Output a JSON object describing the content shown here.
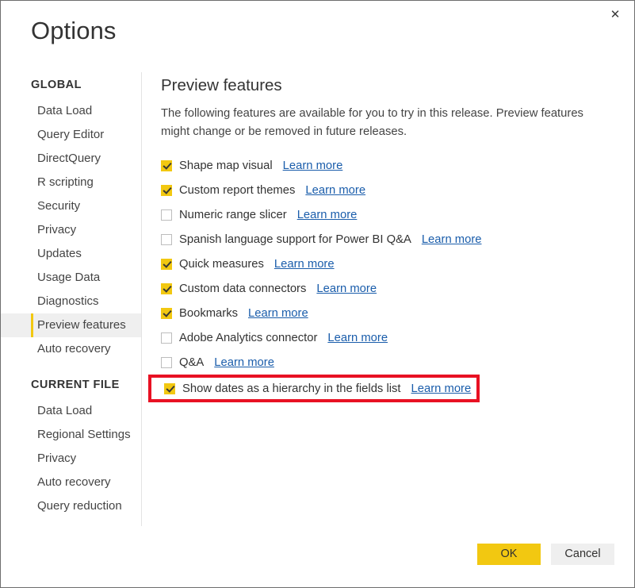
{
  "window": {
    "title": "Options",
    "close_icon": "close-icon",
    "close_glyph": "✕"
  },
  "sidebar": {
    "groups": [
      {
        "title": "GLOBAL",
        "items": [
          {
            "label": "Data Load",
            "selected": false
          },
          {
            "label": "Query Editor",
            "selected": false
          },
          {
            "label": "DirectQuery",
            "selected": false
          },
          {
            "label": "R scripting",
            "selected": false
          },
          {
            "label": "Security",
            "selected": false
          },
          {
            "label": "Privacy",
            "selected": false
          },
          {
            "label": "Updates",
            "selected": false
          },
          {
            "label": "Usage Data",
            "selected": false
          },
          {
            "label": "Diagnostics",
            "selected": false
          },
          {
            "label": "Preview features",
            "selected": true
          },
          {
            "label": "Auto recovery",
            "selected": false
          }
        ]
      },
      {
        "title": "CURRENT FILE",
        "items": [
          {
            "label": "Data Load",
            "selected": false
          },
          {
            "label": "Regional Settings",
            "selected": false
          },
          {
            "label": "Privacy",
            "selected": false
          },
          {
            "label": "Auto recovery",
            "selected": false
          },
          {
            "label": "Query reduction",
            "selected": false
          }
        ]
      }
    ]
  },
  "main": {
    "heading": "Preview features",
    "description": "The following features are available for you to try in this release. Preview features might change or be removed in future releases.",
    "learn_more_label": "Learn more",
    "features": [
      {
        "label": "Shape map visual",
        "checked": true,
        "highlighted": false
      },
      {
        "label": "Custom report themes",
        "checked": true,
        "highlighted": false
      },
      {
        "label": "Numeric range slicer",
        "checked": false,
        "highlighted": false
      },
      {
        "label": "Spanish language support for Power BI Q&A",
        "checked": false,
        "highlighted": false
      },
      {
        "label": "Quick measures",
        "checked": true,
        "highlighted": false
      },
      {
        "label": "Custom data connectors",
        "checked": true,
        "highlighted": false
      },
      {
        "label": "Bookmarks",
        "checked": true,
        "highlighted": false
      },
      {
        "label": "Adobe Analytics connector",
        "checked": false,
        "highlighted": false
      },
      {
        "label": "Q&A",
        "checked": false,
        "highlighted": false
      },
      {
        "label": "Show dates as a hierarchy in the fields list",
        "checked": true,
        "highlighted": true
      }
    ]
  },
  "footer": {
    "ok_label": "OK",
    "cancel_label": "Cancel"
  },
  "colors": {
    "accent": "#f2c811",
    "link": "#1a5dab",
    "highlight": "#e81123",
    "selected_bg": "#efefef"
  }
}
